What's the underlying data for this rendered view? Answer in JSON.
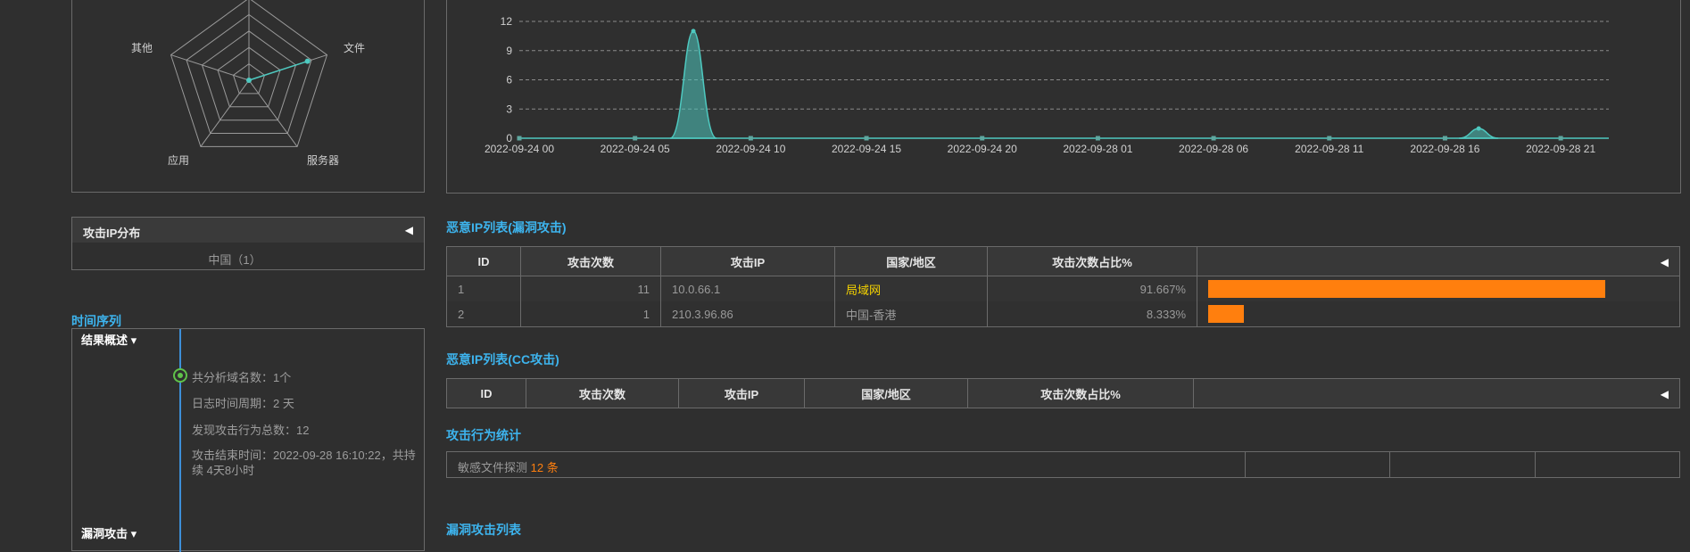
{
  "radar": {
    "labels": [
      "文件",
      "服务器",
      "应用",
      "其他"
    ]
  },
  "ip_distribution": {
    "title": "攻击IP分布",
    "toggle": "◀",
    "items": [
      "中国（1）"
    ]
  },
  "timeline": {
    "section_title": "时间序列",
    "result_group": "结果概述 ▾",
    "vuln_group": "漏洞攻击 ▾",
    "entries": [
      "共分析域名数：1个",
      "日志时间周期：2 天",
      "发现攻击行为总数：12",
      "攻击结束时间：2022-09-28 16:10:22，共持续 4天8小时"
    ]
  },
  "chart_data": {
    "type": "area",
    "x_ticks": [
      "2022-09-24 00",
      "2022-09-24 05",
      "2022-09-24 10",
      "2022-09-24 15",
      "2022-09-24 20",
      "2022-09-28 01",
      "2022-09-28 06",
      "2022-09-28 11",
      "2022-09-28 16",
      "2022-09-28 21"
    ],
    "y_ticks": [
      0,
      3,
      6,
      9,
      12
    ],
    "ylim": [
      0,
      12
    ],
    "grid": true,
    "series": [
      {
        "color": "#4ec9c0",
        "points": [
          {
            "x": 0,
            "y": 0
          },
          {
            "x": 7.9,
            "y": 0
          },
          {
            "x": 8,
            "y": 11
          },
          {
            "x": 8.1,
            "y": 0
          },
          {
            "x": 44,
            "y": 0
          },
          {
            "x": 44.1,
            "y": 1
          },
          {
            "x": 44.2,
            "y": 0
          },
          {
            "x": 50,
            "y": 0
          }
        ]
      }
    ]
  },
  "vuln_table": {
    "title": "恶意IP列表(漏洞攻击)",
    "columns": [
      "ID",
      "攻击次数",
      "攻击IP",
      "国家/地区",
      "攻击次数占比%"
    ],
    "toggle": "◀",
    "rows": [
      {
        "id": "1",
        "count": "11",
        "ip": "10.0.66.1",
        "region": "局域网",
        "pct": "91.667%",
        "ratio": 0.91667
      },
      {
        "id": "2",
        "count": "1",
        "ip": "210.3.96.86",
        "region": "中国-香港",
        "pct": "8.333%",
        "ratio": 0.08333
      }
    ]
  },
  "cc_table": {
    "title": "恶意IP列表(CC攻击)",
    "columns": [
      "ID",
      "攻击次数",
      "攻击IP",
      "国家/地区",
      "攻击次数占比%"
    ],
    "toggle": "◀"
  },
  "attack_stats": {
    "title": "攻击行为统计",
    "label": "敏感文件探测",
    "count": "12 条"
  },
  "vuln_list": {
    "title": "漏洞攻击列表"
  },
  "colors": {
    "accent": "#3db4ee",
    "bar": "#ff7f0e",
    "series": "#4ec9c0",
    "region_lan": "#f5d300"
  }
}
